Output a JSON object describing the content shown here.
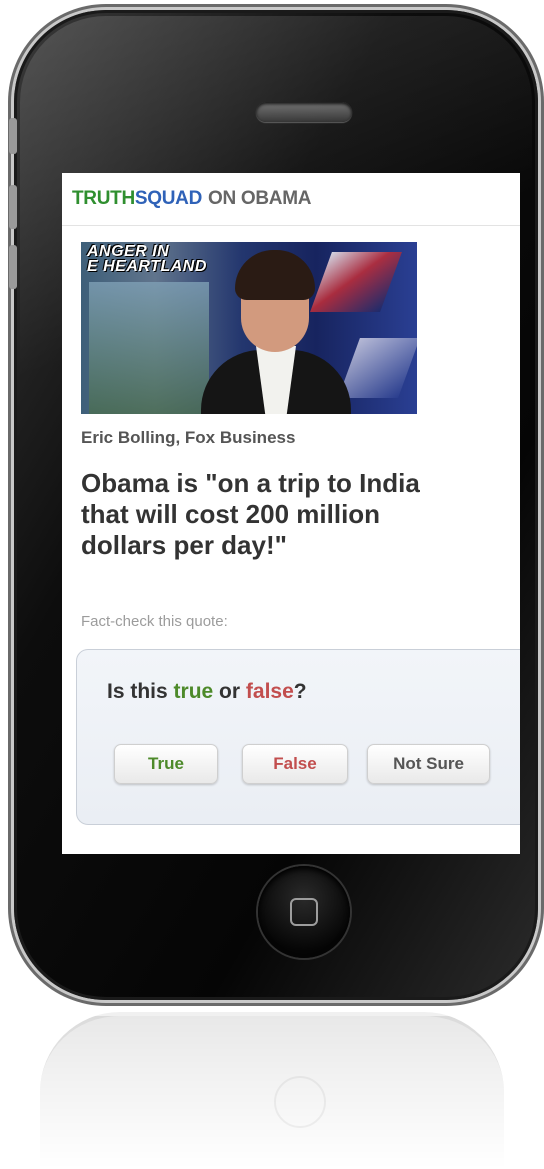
{
  "brand": {
    "part1": "TRUTH",
    "part2": "SQUAD",
    "part3": "ON OBAMA"
  },
  "video": {
    "caption": "ANGER IN\nE HEARTLAND"
  },
  "article": {
    "source": "Eric Bolling, Fox Business",
    "quote": "Obama is \"on a trip to India\nthat will cost 200 million\ndollars per day!\"",
    "fact_check_label": "Fact-check this quote:"
  },
  "poll": {
    "q_prefix": "Is this ",
    "q_true": "true",
    "q_mid": " or ",
    "q_false": "false",
    "q_suffix": "?",
    "buttons": {
      "true_label": "True",
      "false_label": "False",
      "notsure_label": "Not Sure"
    }
  },
  "colors": {
    "truth_green": "#2f8f2f",
    "squad_blue": "#2f62b8",
    "false_red": "#c24e4e"
  }
}
